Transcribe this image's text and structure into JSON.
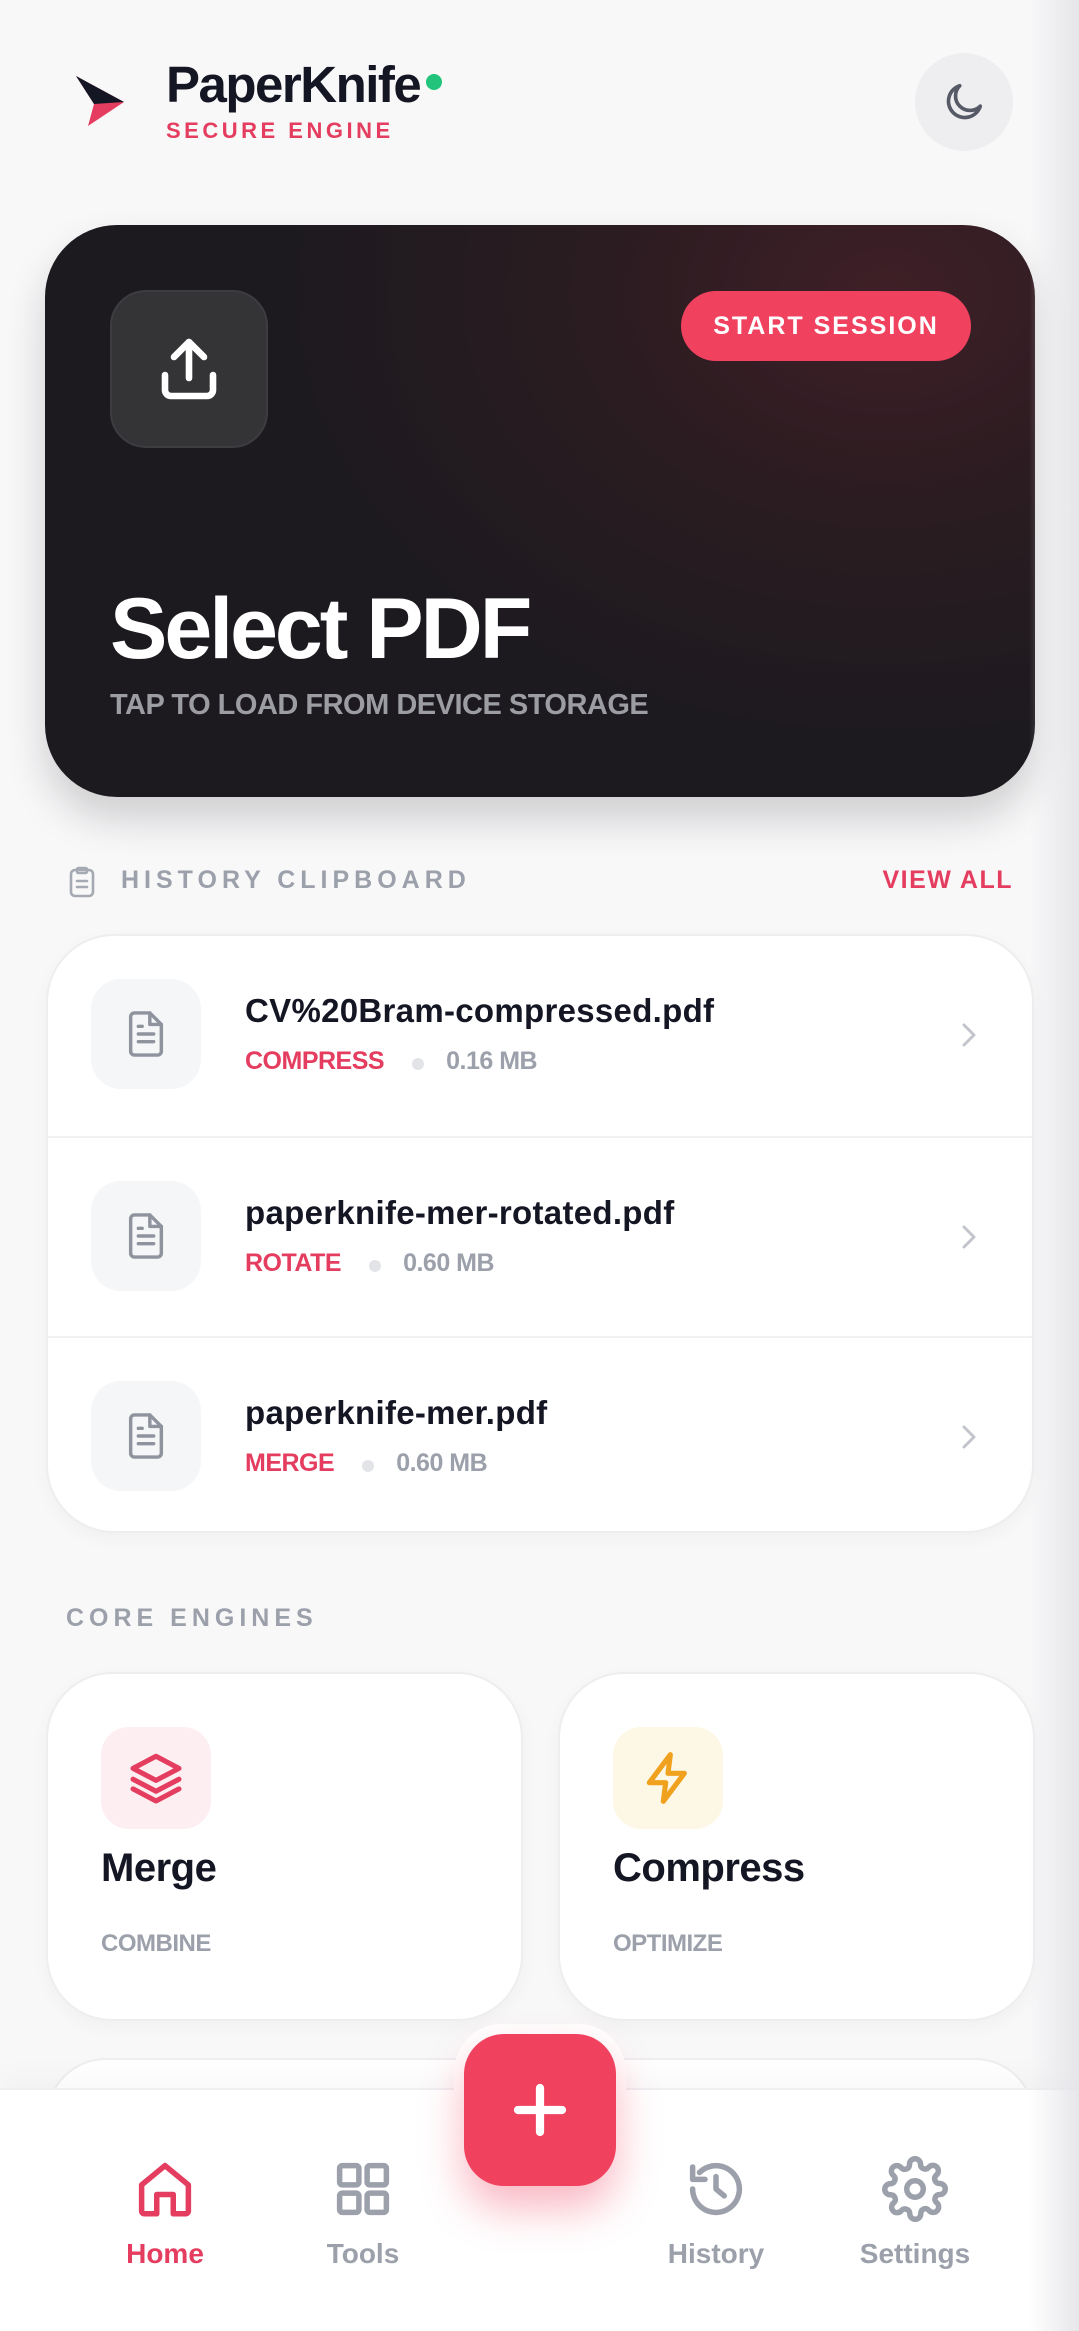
{
  "app": {
    "name": "PaperKnife",
    "tagline": "SECURE ENGINE"
  },
  "header": {
    "theme_icon": "moon-icon",
    "status_color": "#22c37a"
  },
  "hero": {
    "button_label": "START SESSION",
    "title": "Select PDF",
    "subtitle": "TAP TO LOAD FROM DEVICE STORAGE",
    "icon": "upload-icon"
  },
  "history": {
    "section_label": "HISTORY CLIPBOARD",
    "view_all_label": "VIEW ALL",
    "items": [
      {
        "name": "CV%20Bram-compressed.pdf",
        "operation": "COMPRESS",
        "size": "0.16 MB"
      },
      {
        "name": "paperknife-mer-rotated.pdf",
        "operation": "ROTATE",
        "size": "0.60 MB"
      },
      {
        "name": "paperknife-mer.pdf",
        "operation": "MERGE",
        "size": "0.60 MB"
      }
    ]
  },
  "core_engines": {
    "section_label": "CORE ENGINES",
    "items": [
      {
        "title": "Merge",
        "subtitle": "COMBINE",
        "icon": "layers-icon",
        "accent": "#e43d5f"
      },
      {
        "title": "Compress",
        "subtitle": "OPTIMIZE",
        "icon": "lightning-icon",
        "accent": "#f0a21f"
      }
    ]
  },
  "nav": {
    "items": [
      {
        "label": "Home",
        "icon": "home-icon",
        "active": true
      },
      {
        "label": "Tools",
        "icon": "grid-icon",
        "active": false
      },
      {
        "label": "History",
        "icon": "history-icon",
        "active": false
      },
      {
        "label": "Settings",
        "icon": "gear-icon",
        "active": false
      }
    ],
    "fab_icon": "plus-icon"
  },
  "colors": {
    "accent": "#e43d5f",
    "button": "#f0415f",
    "muted": "#9ba0aa",
    "hero_bg": "#1c1a1f"
  }
}
